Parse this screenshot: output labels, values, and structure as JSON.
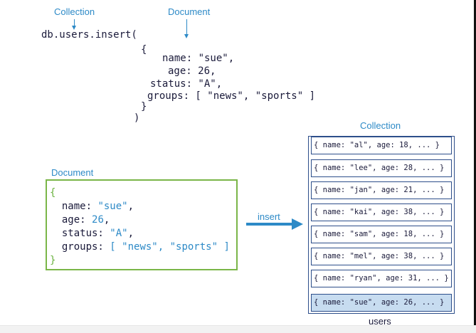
{
  "top": {
    "collection_label": "Collection",
    "document_label": "Document",
    "lines": [
      "db.users.insert(",
      "{",
      "name: \"sue\",",
      "age: 26,",
      "status: \"A\",",
      "groups: [ \"news\", \"sports\" ]",
      "}",
      ")"
    ]
  },
  "document": {
    "label": "Document",
    "open": "{",
    "close": "}",
    "fields": [
      {
        "key": "name: ",
        "value": "\"sue\"",
        "sep": ","
      },
      {
        "key": "age: ",
        "value": "26",
        "sep": ","
      },
      {
        "key": "status: ",
        "value": "\"A\"",
        "sep": ","
      },
      {
        "key": "groups: ",
        "value": "[ \"news\", \"sports\" ]",
        "sep": ""
      }
    ]
  },
  "arrow": {
    "label": "insert"
  },
  "collection": {
    "label": "Collection",
    "name": "users",
    "rows": [
      "{ name: \"al\", age: 18, ... }",
      "{ name: \"lee\", age: 28, ... }",
      "{ name: \"jan\", age: 21, ... }",
      "{ name: \"kai\", age: 38, ... }",
      "{ name: \"sam\", age: 18, ... }",
      "{ name: \"mel\", age: 38, ... }",
      "{ name: \"ryan\", age: 31, ... }",
      "{ name: \"sue\", age: 26, ... }"
    ],
    "highlight_color": "#c7dcf0",
    "border_color": "#2d4e8a"
  },
  "colors": {
    "accent": "#2d8ac7",
    "doc_border": "#7ab648",
    "text": "#1a1a3a"
  }
}
